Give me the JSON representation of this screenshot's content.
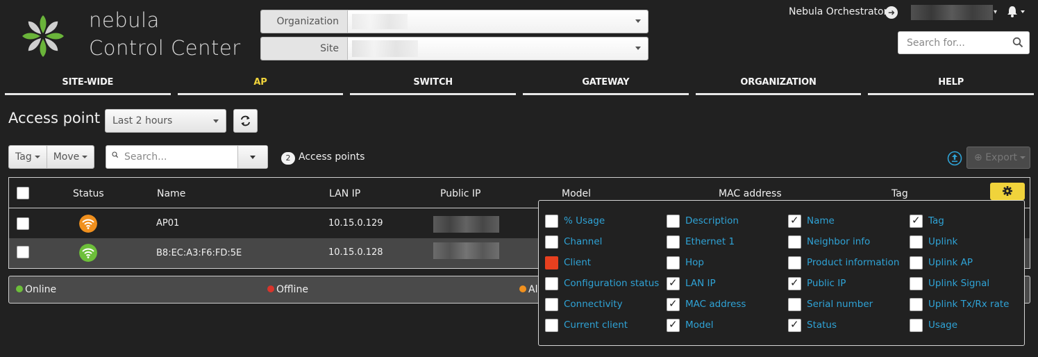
{
  "brand": {
    "line1": "nebula",
    "line2": "Control Center"
  },
  "selectors": [
    {
      "label": "Organization",
      "value": ""
    },
    {
      "label": "Site",
      "value": ""
    }
  ],
  "top_right": {
    "orchestrator": "Nebula Orchestrator",
    "search_placeholder": "Search for..."
  },
  "nav": [
    "SITE-WIDE",
    "AP",
    "SWITCH",
    "GATEWAY",
    "ORGANIZATION",
    "HELP"
  ],
  "nav_active": "AP",
  "page": {
    "title": "Access point",
    "time_range": "Last 2 hours"
  },
  "toolbar": {
    "tag": "Tag",
    "move": "Move",
    "search_placeholder": "Search...",
    "count": "2",
    "count_label": "Access points",
    "export": "Export"
  },
  "table": {
    "headers": [
      "Status",
      "Name",
      "LAN IP",
      "Public IP",
      "Model",
      "MAC address",
      "Tag"
    ],
    "rows": [
      {
        "status": "alert",
        "name": "AP01",
        "lan_ip": "10.15.0.129"
      },
      {
        "status": "online",
        "name": "B8:EC:A3:F6:FD:5E",
        "lan_ip": "10.15.0.128"
      }
    ]
  },
  "legend": [
    {
      "label": "Online",
      "color": "#6dbf3a"
    },
    {
      "label": "Offline",
      "color": "#d9342b"
    },
    {
      "label": "Al",
      "color": "#f0901e"
    }
  ],
  "column_chooser": {
    "options": [
      {
        "label": "% Usage",
        "state": "unchecked"
      },
      {
        "label": "Channel",
        "state": "unchecked"
      },
      {
        "label": "Client",
        "state": "red"
      },
      {
        "label": "Configuration status",
        "state": "unchecked"
      },
      {
        "label": "Connectivity",
        "state": "unchecked"
      },
      {
        "label": "Current client",
        "state": "unchecked"
      },
      {
        "label": "Description",
        "state": "unchecked"
      },
      {
        "label": "Ethernet 1",
        "state": "unchecked"
      },
      {
        "label": "Hop",
        "state": "unchecked"
      },
      {
        "label": "LAN IP",
        "state": "checked"
      },
      {
        "label": "MAC address",
        "state": "checked"
      },
      {
        "label": "Model",
        "state": "checked"
      },
      {
        "label": "Name",
        "state": "checked"
      },
      {
        "label": "Neighbor info",
        "state": "unchecked"
      },
      {
        "label": "Product information",
        "state": "unchecked"
      },
      {
        "label": "Public IP",
        "state": "checked"
      },
      {
        "label": "Serial number",
        "state": "unchecked"
      },
      {
        "label": "Status",
        "state": "checked"
      },
      {
        "label": "Tag",
        "state": "checked"
      },
      {
        "label": "Uplink",
        "state": "unchecked"
      },
      {
        "label": "Uplink AP",
        "state": "unchecked"
      },
      {
        "label": "Uplink Signal",
        "state": "unchecked"
      },
      {
        "label": "Uplink Tx/Rx rate",
        "state": "unchecked"
      },
      {
        "label": "Usage",
        "state": "unchecked"
      }
    ]
  },
  "colors": {
    "accent_yellow": "#f0d33b",
    "link_blue": "#2fa3d6",
    "status_online": "#6dbf3a",
    "status_alert": "#f0901e"
  }
}
